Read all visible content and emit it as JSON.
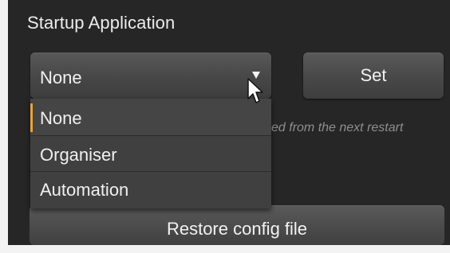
{
  "section": {
    "title": "Startup Application"
  },
  "select": {
    "value": "None"
  },
  "set_button": {
    "label": "Set"
  },
  "info_text": "ed from the next restart",
  "dropdown": {
    "options": [
      {
        "label": "None",
        "selected": true
      },
      {
        "label": "Organiser",
        "selected": false
      },
      {
        "label": "Automation",
        "selected": false
      }
    ]
  },
  "restore_button": {
    "label": "Restore config file"
  },
  "colors": {
    "panel_bg": "#262626",
    "selection_marker": "#e8a23c"
  },
  "icons": {
    "dropdown_arrow": "triangle-down-icon",
    "pointer": "mouse-cursor-icon"
  }
}
